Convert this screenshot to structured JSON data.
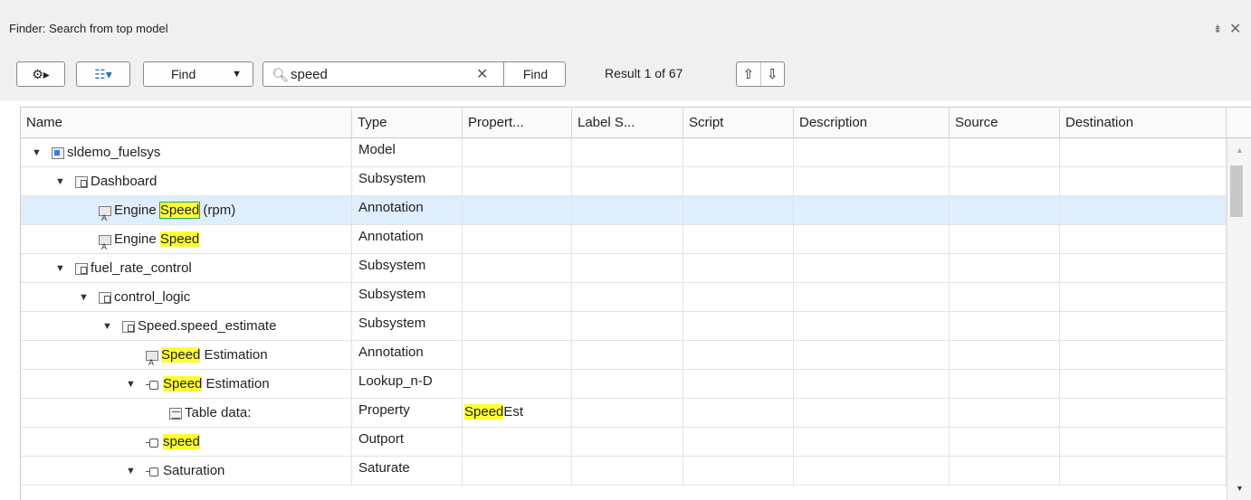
{
  "window": {
    "title": "Finder: Search from top model",
    "pin_glyph": "⇟",
    "close_glyph": "✕"
  },
  "toolbar": {
    "gear_glyph": "⚙▸",
    "view_glyph": "☷▾",
    "find_label": "Find",
    "find_caret": "▼",
    "search_icon": "🔍︎",
    "search_value": "speed",
    "clear_glyph": "✕",
    "find_button": "Find",
    "result_text": "Result 1 of 67",
    "prev_glyph": "⇧",
    "next_glyph": "⇩"
  },
  "columns": [
    "Name",
    "Type",
    "Propert...",
    "Label S...",
    "Script",
    "Description",
    "Source",
    "Destination"
  ],
  "rows": [
    {
      "name_pre": "sldemo_fuelsys",
      "match": "",
      "name_post": "",
      "type": "Model",
      "prop_match": "",
      "prop_post": "",
      "arrow": "▼",
      "icon": "model-icon",
      "level": 0,
      "selected": false
    },
    {
      "name_pre": "Dashboard",
      "match": "",
      "name_post": "",
      "type": "Subsystem",
      "prop_match": "",
      "prop_post": "",
      "arrow": "▼",
      "icon": "subsystem-icon",
      "level": 1,
      "selected": false
    },
    {
      "name_pre": "Engine ",
      "match": "Speed",
      "name_post": " (rpm)",
      "type": "Annotation",
      "prop_match": "",
      "prop_post": "",
      "arrow": "",
      "icon": "annotation-icon",
      "level": 2,
      "selected": true
    },
    {
      "name_pre": "Engine ",
      "match": "Speed",
      "name_post": "",
      "type": "Annotation",
      "prop_match": "",
      "prop_post": "",
      "arrow": "",
      "icon": "annotation-icon",
      "level": 2,
      "selected": false
    },
    {
      "name_pre": "fuel_rate_control",
      "match": "",
      "name_post": "",
      "type": "Subsystem",
      "prop_match": "",
      "prop_post": "",
      "arrow": "▼",
      "icon": "subsystem-icon",
      "level": 1,
      "selected": false
    },
    {
      "name_pre": "control_logic",
      "match": "",
      "name_post": "",
      "type": "Subsystem",
      "prop_match": "",
      "prop_post": "",
      "arrow": "▼",
      "icon": "subsystem-icon",
      "level": 2,
      "selected": false
    },
    {
      "name_pre": "Speed.speed_estimate",
      "match": "",
      "name_post": "",
      "type": "Subsystem",
      "prop_match": "",
      "prop_post": "",
      "arrow": "▼",
      "icon": "subsystem-icon",
      "level": 3,
      "selected": false
    },
    {
      "name_pre": "",
      "match": "Speed",
      "name_post": " Estimation",
      "type": "Annotation",
      "prop_match": "",
      "prop_post": "",
      "arrow": "",
      "icon": "annotation-icon",
      "level": 4,
      "selected": false
    },
    {
      "name_pre": "",
      "match": "Speed",
      "name_post": " Estimation",
      "type": "Lookup_n-D",
      "prop_match": "",
      "prop_post": "",
      "arrow": "▼",
      "icon": "block-port-icon",
      "level": 4,
      "selected": false
    },
    {
      "name_pre": "Table data:",
      "match": "",
      "name_post": "",
      "type": "Property",
      "prop_match": "Speed",
      "prop_post": "Est",
      "arrow": "",
      "icon": "table-icon",
      "level": 5,
      "selected": false
    },
    {
      "name_pre": "",
      "match": "speed",
      "name_post": "",
      "type": "Outport",
      "prop_match": "",
      "prop_post": "",
      "arrow": "",
      "icon": "port-icon",
      "level": 4,
      "selected": false
    },
    {
      "name_pre": "Saturation",
      "match": "",
      "name_post": "",
      "type": "Saturate",
      "prop_match": "",
      "prop_post": "",
      "arrow": "▼",
      "icon": "block-port-icon",
      "level": 4,
      "selected": false
    }
  ],
  "colors": {
    "selection": "#deeefc",
    "highlight": "#ffff33",
    "outline": "#21a85c"
  }
}
